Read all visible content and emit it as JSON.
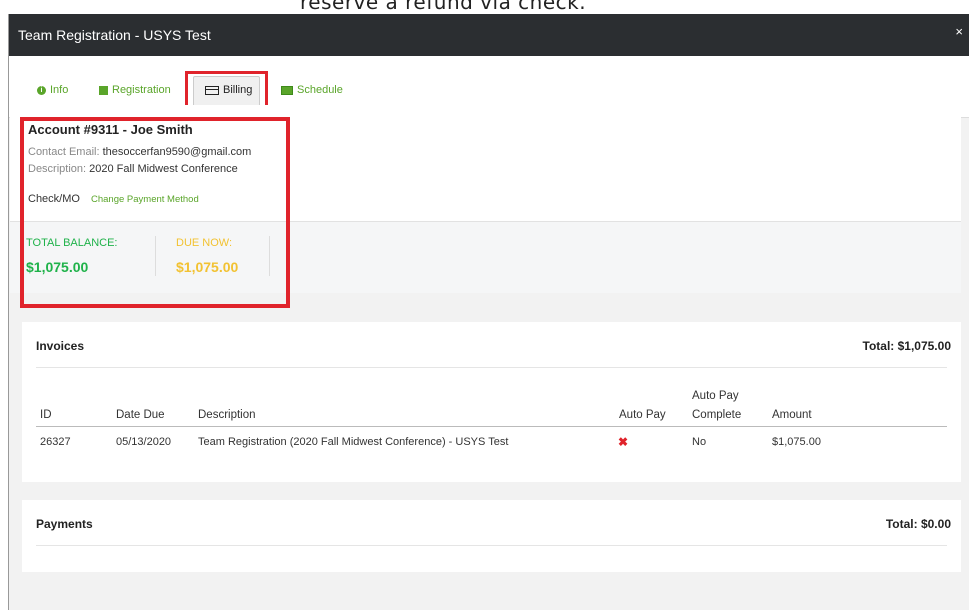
{
  "background_text": "reserve a refund via check.",
  "modal": {
    "title": "Team Registration - USYS Test",
    "close_label": "×"
  },
  "tabs": [
    {
      "label": "Info",
      "icon": "info-icon"
    },
    {
      "label": "Registration",
      "icon": "registration-icon"
    },
    {
      "label": "Billing",
      "icon": "credit-card-icon",
      "active": true
    },
    {
      "label": "Schedule",
      "icon": "calendar-icon"
    }
  ],
  "account": {
    "title": "Account #9311 - Joe Smith",
    "contact_label": "Contact Email:",
    "contact_value": "thesoccerfan9590@gmail.com",
    "description_label": "Description:",
    "description_value": "2020 Fall Midwest Conference",
    "payment_method": "Check/MO",
    "change_payment_label": "Change Payment Method",
    "total_balance_label": "TOTAL BALANCE:",
    "total_balance_value": "$1,075.00",
    "due_now_label": "DUE NOW:",
    "due_now_value": "$1,075.00"
  },
  "invoices": {
    "title": "Invoices",
    "total": "Total: $1,075.00",
    "headers": {
      "id": "ID",
      "date_due": "Date Due",
      "description": "Description",
      "auto_pay": "Auto Pay",
      "auto_pay_complete_1": "Auto Pay",
      "auto_pay_complete_2": "Complete",
      "amount": "Amount"
    },
    "rows": [
      {
        "id": "26327",
        "date_due": "05/13/2020",
        "description": "Team Registration (2020 Fall Midwest Conference) - USYS Test",
        "auto_pay": "✖",
        "auto_pay_complete": "No",
        "amount": "$1,075.00"
      }
    ]
  },
  "payments": {
    "title": "Payments",
    "total": "Total: $0.00"
  },
  "colors": {
    "accent_green": "#5aa52a",
    "balance_green": "#1fb24a",
    "due_yellow": "#f2c232",
    "highlight_red": "#e0232b",
    "header_dark": "#2b2e31"
  }
}
